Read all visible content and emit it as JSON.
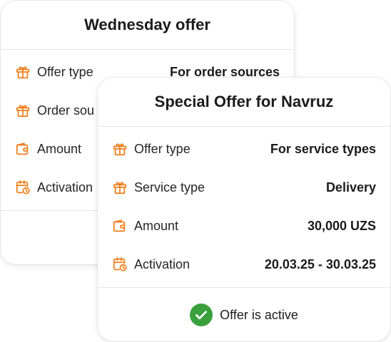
{
  "colors": {
    "accent": "#f07d1a",
    "success": "#3aa03c"
  },
  "back_card": {
    "title": "Wednesday offer",
    "rows": [
      {
        "icon": "gift-icon",
        "label": "Offer type",
        "value": "For order sources"
      },
      {
        "icon": "gift-icon",
        "label": "Order sou"
      },
      {
        "icon": "wallet-icon",
        "label": "Amount"
      },
      {
        "icon": "calendar-clock-icon",
        "label": "Activation"
      }
    ]
  },
  "front_card": {
    "title": "Special Offer for Navruz",
    "rows": [
      {
        "icon": "gift-icon",
        "label": "Offer type",
        "value": "For service types"
      },
      {
        "icon": "gift-icon",
        "label": "Service type",
        "value": "Delivery"
      },
      {
        "icon": "wallet-icon",
        "label": "Amount",
        "value": "30,000 UZS"
      },
      {
        "icon": "calendar-clock-icon",
        "label": "Activation",
        "value": "20.03.25 - 30.03.25"
      }
    ],
    "status": {
      "icon": "check-circle-icon",
      "text": "Offer is active"
    }
  }
}
